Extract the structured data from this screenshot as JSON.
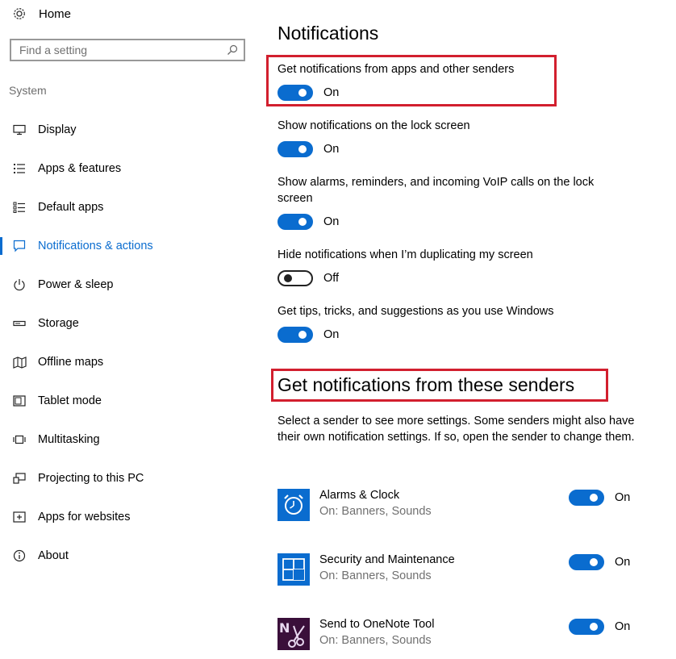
{
  "sidebar": {
    "home_label": "Home",
    "search_placeholder": "Find a setting",
    "section_label": "System",
    "items": [
      {
        "label": "Display",
        "icon": "monitor-icon"
      },
      {
        "label": "Apps & features",
        "icon": "list-icon"
      },
      {
        "label": "Default apps",
        "icon": "default-apps-icon"
      },
      {
        "label": "Notifications & actions",
        "icon": "speech-bubble-icon",
        "active": true
      },
      {
        "label": "Power & sleep",
        "icon": "power-icon"
      },
      {
        "label": "Storage",
        "icon": "storage-icon"
      },
      {
        "label": "Offline maps",
        "icon": "map-icon"
      },
      {
        "label": "Tablet mode",
        "icon": "tablet-icon"
      },
      {
        "label": "Multitasking",
        "icon": "multitasking-icon"
      },
      {
        "label": "Projecting to this PC",
        "icon": "projecting-icon"
      },
      {
        "label": "Apps for websites",
        "icon": "apps-websites-icon"
      },
      {
        "label": "About",
        "icon": "info-icon"
      }
    ]
  },
  "main": {
    "title": "Notifications",
    "settings": [
      {
        "label": "Get notifications from apps and other senders",
        "state": "On"
      },
      {
        "label": "Show notifications on the lock screen",
        "state": "On"
      },
      {
        "label": "Show alarms, reminders, and incoming VoIP calls on the lock screen",
        "state": "On"
      },
      {
        "label": "Hide notifications when I’m duplicating my screen",
        "state": "Off"
      },
      {
        "label": "Get tips, tricks, and suggestions as you use Windows",
        "state": "On"
      }
    ],
    "senders_title": "Get notifications from these senders",
    "senders_desc": "Select a sender to see more settings. Some senders might also have their own notification settings. If so, open the sender to change them.",
    "senders": [
      {
        "name": "Alarms & Clock",
        "sub": "On: Banners, Sounds",
        "state": "On",
        "icon": "alarm-clock-icon"
      },
      {
        "name": "Security and Maintenance",
        "sub": "On: Banners, Sounds",
        "state": "On",
        "icon": "security-maintenance-icon"
      },
      {
        "name": "Send to OneNote Tool",
        "sub": "On: Banners, Sounds",
        "state": "On",
        "icon": "onenote-tool-icon"
      }
    ]
  },
  "colors": {
    "accent": "#0a6ccf",
    "highlight_box": "#d21f2e"
  }
}
